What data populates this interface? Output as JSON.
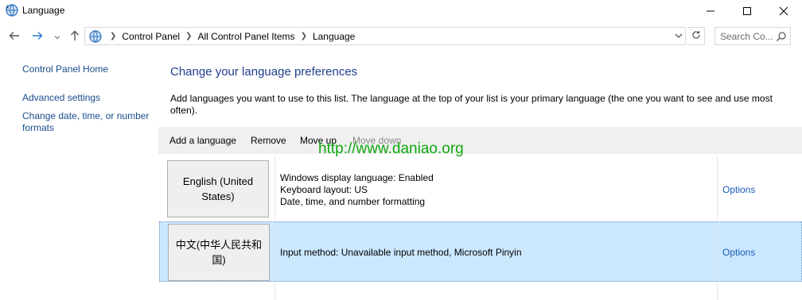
{
  "window": {
    "title": "Language"
  },
  "nav": {
    "breadcrumbs": [
      "Control Panel",
      "All Control Panel Items",
      "Language"
    ],
    "search_placeholder": "Search Co..."
  },
  "sidebar": {
    "items": [
      {
        "label": "Control Panel Home"
      },
      {
        "label": "Advanced settings"
      },
      {
        "label": "Change date, time, or number formats"
      }
    ]
  },
  "main": {
    "heading": "Change your language preferences",
    "description": "Add languages you want to use to this list. The language at the top of your list is your primary language (the one you want to see and use most often).",
    "toolbar": {
      "add_label": "Add a language",
      "remove_label": "Remove",
      "move_up_label": "Move up",
      "move_down_label": "Move down"
    },
    "languages": [
      {
        "name": "English (United States)",
        "details": [
          "Windows display language: Enabled",
          "Keyboard layout: US",
          "Date, time, and number formatting"
        ],
        "options_label": "Options",
        "selected": false
      },
      {
        "name": "中文(中华人民共和国)",
        "details": [
          "Input method: Unavailable input method, Microsoft Pinyin"
        ],
        "options_label": "Options",
        "selected": true
      }
    ]
  },
  "overlay": {
    "watermark": "http://www.daniao.org"
  },
  "colors": {
    "link": "#1a4c8c",
    "heading": "#1e3e8c",
    "selection": "#cce8ff",
    "watermark": "#10a810"
  }
}
